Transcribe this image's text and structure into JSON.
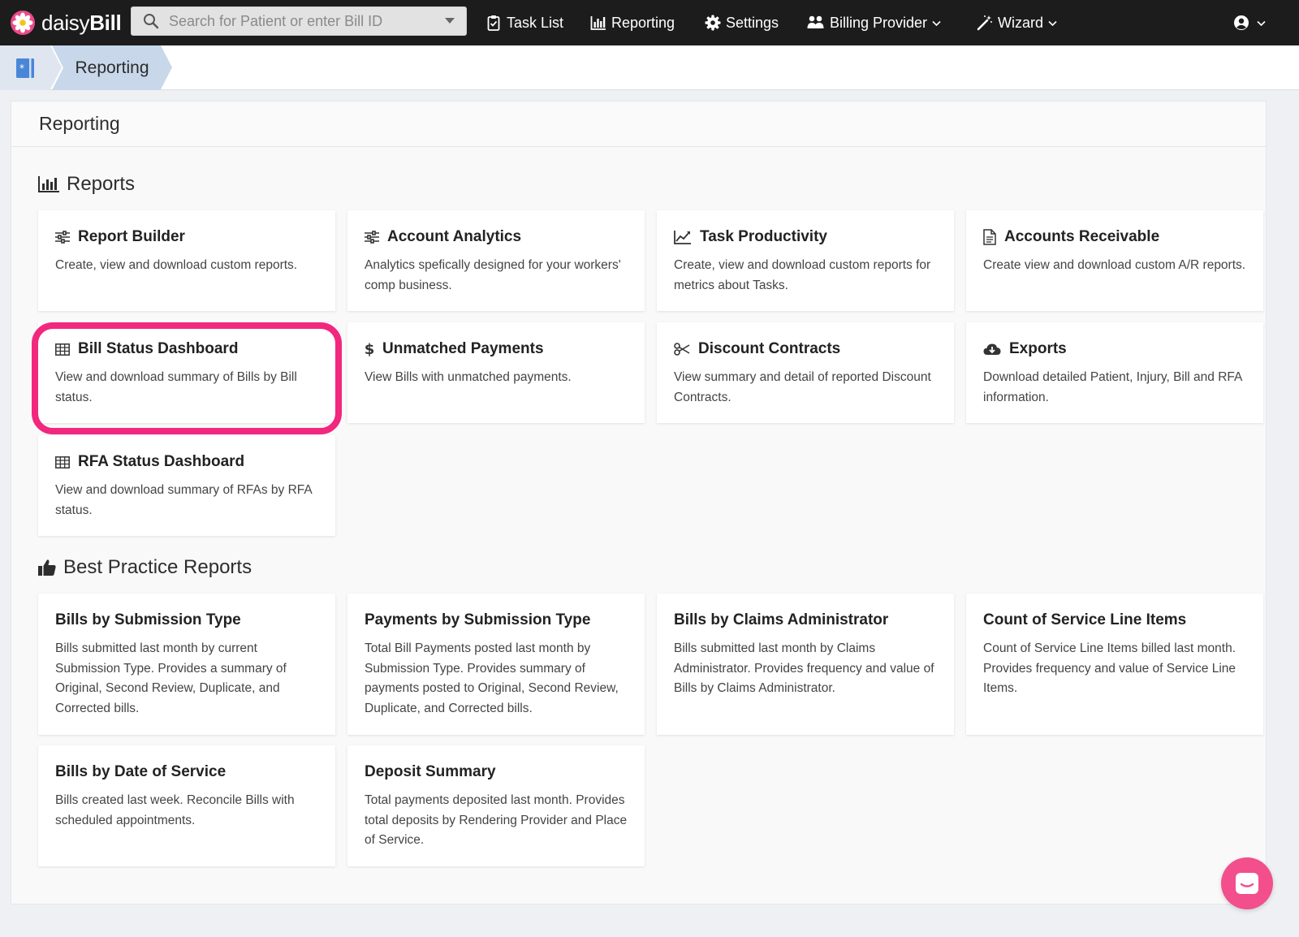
{
  "brand": {
    "name_light": "daisy",
    "name_bold": "Bill"
  },
  "search": {
    "placeholder": "Search for Patient or enter Bill ID"
  },
  "nav": {
    "task_list": "Task List",
    "reporting": "Reporting",
    "settings": "Settings",
    "billing_provider": "Billing Provider",
    "wizard": "Wizard"
  },
  "breadcrumb": {
    "current": "Reporting"
  },
  "page": {
    "title": "Reporting"
  },
  "reports": {
    "heading": "Reports",
    "cards": [
      {
        "title": "Report Builder",
        "desc": "Create, view and download custom reports.",
        "icon": "sliders-icon"
      },
      {
        "title": "Account Analytics",
        "desc": "Analytics spefically designed for your workers' comp business.",
        "icon": "sliders-icon"
      },
      {
        "title": "Task Productivity",
        "desc": "Create, view and download custom reports for metrics about Tasks.",
        "icon": "line-chart-icon"
      },
      {
        "title": "Accounts Receivable",
        "desc": "Create view and download custom A/R reports.",
        "icon": "document-icon"
      },
      {
        "title": "Bill Status Dashboard",
        "desc": "View and download summary of Bills by Bill status.",
        "icon": "table-icon"
      },
      {
        "title": "Unmatched Payments",
        "desc": "View Bills with unmatched payments.",
        "icon": "dollar-icon"
      },
      {
        "title": "Discount Contracts",
        "desc": "View summary and detail of reported Discount Contracts.",
        "icon": "scissors-icon"
      },
      {
        "title": "Exports",
        "desc": "Download detailed Patient, Injury, Bill and RFA information.",
        "icon": "cloud-download-icon"
      },
      {
        "title": "RFA Status Dashboard",
        "desc": "View and download summary of RFAs by RFA status.",
        "icon": "table-icon"
      }
    ]
  },
  "best_practice": {
    "heading": "Best Practice Reports",
    "cards": [
      {
        "title": "Bills by Submission Type",
        "desc": "Bills submitted last month by current Submission Type. Provides a summary of Original, Second Review, Duplicate, and Corrected bills."
      },
      {
        "title": "Payments by Submission Type",
        "desc": "Total Bill Payments posted last month by Submission Type. Provides summary of payments posted to Original, Second Review, Duplicate, and Corrected bills."
      },
      {
        "title": "Bills by Claims Administrator",
        "desc": "Bills submitted last month by Claims Administrator. Provides frequency and value of Bills by Claims Administrator."
      },
      {
        "title": "Count of Service Line Items",
        "desc": "Count of Service Line Items billed last month. Provides frequency and value of Service Line Items."
      },
      {
        "title": "Bills by Date of Service",
        "desc": "Bills created last week. Reconcile Bills with scheduled appointments."
      },
      {
        "title": "Deposit Summary",
        "desc": "Total payments deposited last month. Provides total deposits by Rendering Provider and Place of Service."
      }
    ]
  },
  "colors": {
    "nav_bg": "#1c1c1c",
    "breadcrumb_active": "#c8d7ea",
    "highlight": "#f2277e",
    "chat": "#f24f8c",
    "brand_pink": "#ec4a8a"
  }
}
